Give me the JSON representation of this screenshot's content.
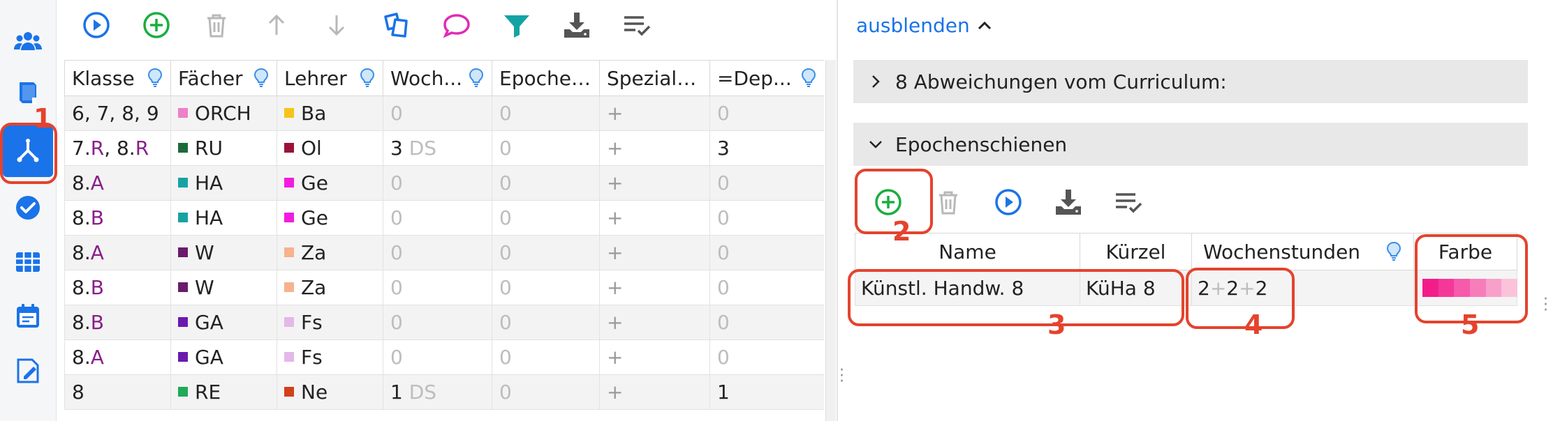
{
  "rail": {
    "items": [
      "users-icon",
      "book-icon",
      "branch-icon",
      "check-circle-icon",
      "table-icon",
      "calendar-icon",
      "edit-document-icon"
    ],
    "active": "branch-icon"
  },
  "toolbar": {
    "buttons": [
      "play-icon",
      "add-icon",
      "delete-icon",
      "arrow-up-icon",
      "arrow-down-icon",
      "copy-icon",
      "comment-icon",
      "filter-icon",
      "download-icon",
      "checklist-icon"
    ]
  },
  "grid": {
    "columns": [
      "Klasse",
      "Fächer",
      "Lehrer",
      "Woch...",
      "Epochen...",
      "Spezialfä...",
      "=Dep..."
    ],
    "rows": [
      {
        "klasse": "6, 7, 8, 9",
        "fach": "ORCH",
        "fach_color": "#ee7fc9",
        "lehrer": "Ba",
        "lehrer_color": "#f5c518",
        "woch": "0",
        "woch_ds": "",
        "epochen": "0",
        "spezial": "+",
        "dep": "0"
      },
      {
        "klasse_a": "7.",
        "klasse_a_l": "R",
        "klasse_b": ", 8.",
        "klasse_b_l": "R",
        "fach": "RU",
        "fach_color": "#1b6b3a",
        "lehrer": "Ol",
        "lehrer_color": "#9b1239",
        "woch": "3",
        "woch_ds": "DS",
        "epochen": "0",
        "spezial": "+",
        "dep": "3"
      },
      {
        "klasse_a": "8.",
        "klasse_a_l": "A",
        "fach": "HA",
        "fach_color": "#17a2a2",
        "lehrer": "Ge",
        "lehrer_color": "#f21ce0",
        "woch": "0",
        "woch_ds": "",
        "epochen": "0",
        "spezial": "+",
        "dep": "0"
      },
      {
        "klasse_a": "8.",
        "klasse_a_l": "B",
        "fach": "HA",
        "fach_color": "#17a2a2",
        "lehrer": "Ge",
        "lehrer_color": "#f21ce0",
        "woch": "0",
        "woch_ds": "",
        "epochen": "0",
        "spezial": "+",
        "dep": "0"
      },
      {
        "klasse_a": "8.",
        "klasse_a_l": "A",
        "fach": "W",
        "fach_color": "#6a1b6a",
        "lehrer": "Za",
        "lehrer_color": "#f7b28e",
        "woch": "0",
        "woch_ds": "",
        "epochen": "0",
        "spezial": "+",
        "dep": "0"
      },
      {
        "klasse_a": "8.",
        "klasse_a_l": "B",
        "fach": "W",
        "fach_color": "#6a1b6a",
        "lehrer": "Za",
        "lehrer_color": "#f7b28e",
        "woch": "0",
        "woch_ds": "",
        "epochen": "0",
        "spezial": "+",
        "dep": "0"
      },
      {
        "klasse_a": "8.",
        "klasse_a_l": "B",
        "fach": "GA",
        "fach_color": "#6a19b0",
        "lehrer": "Fs",
        "lehrer_color": "#e4b8e8",
        "woch": "0",
        "woch_ds": "",
        "epochen": "0",
        "spezial": "+",
        "dep": "0"
      },
      {
        "klasse_a": "8.",
        "klasse_a_l": "A",
        "fach": "GA",
        "fach_color": "#6a19b0",
        "lehrer": "Fs",
        "lehrer_color": "#e4b8e8",
        "woch": "0",
        "woch_ds": "",
        "epochen": "0",
        "spezial": "+",
        "dep": "0"
      },
      {
        "klasse": "8",
        "fach": "RE",
        "fach_color": "#1faa58",
        "lehrer": "Ne",
        "lehrer_color": "#d2401a",
        "woch": "1",
        "woch_ds": "DS",
        "epochen": "0",
        "spezial": "+",
        "dep": "1"
      }
    ]
  },
  "right": {
    "hide_label": "ausblenden",
    "section1": "8 Abweichungen vom Curriculum:",
    "section2": "Epochenschienen",
    "sub_toolbar": [
      "add-icon",
      "delete-icon",
      "play-icon",
      "download-icon",
      "checklist-icon"
    ],
    "table": {
      "columns": [
        "Name",
        "Kürzel",
        "Wochenstunden",
        "Farbe"
      ],
      "row": {
        "name": "Künstl. Handw. 8",
        "kuerzel": "KüHa 8",
        "wochenstunden": [
          "2",
          "2",
          "2"
        ],
        "colors": [
          "#f31d8a",
          "#f5379a",
          "#f65aaa",
          "#f77dba",
          "#f8a0ca",
          "#fac3da"
        ]
      }
    }
  },
  "callouts": [
    "1",
    "2",
    "3",
    "4",
    "5"
  ],
  "colors": {
    "accent": "#1a73e8",
    "callout": "#e4432d",
    "green": "#1aae3f",
    "magenta": "#e12ab5",
    "teal": "#14a3a3"
  }
}
